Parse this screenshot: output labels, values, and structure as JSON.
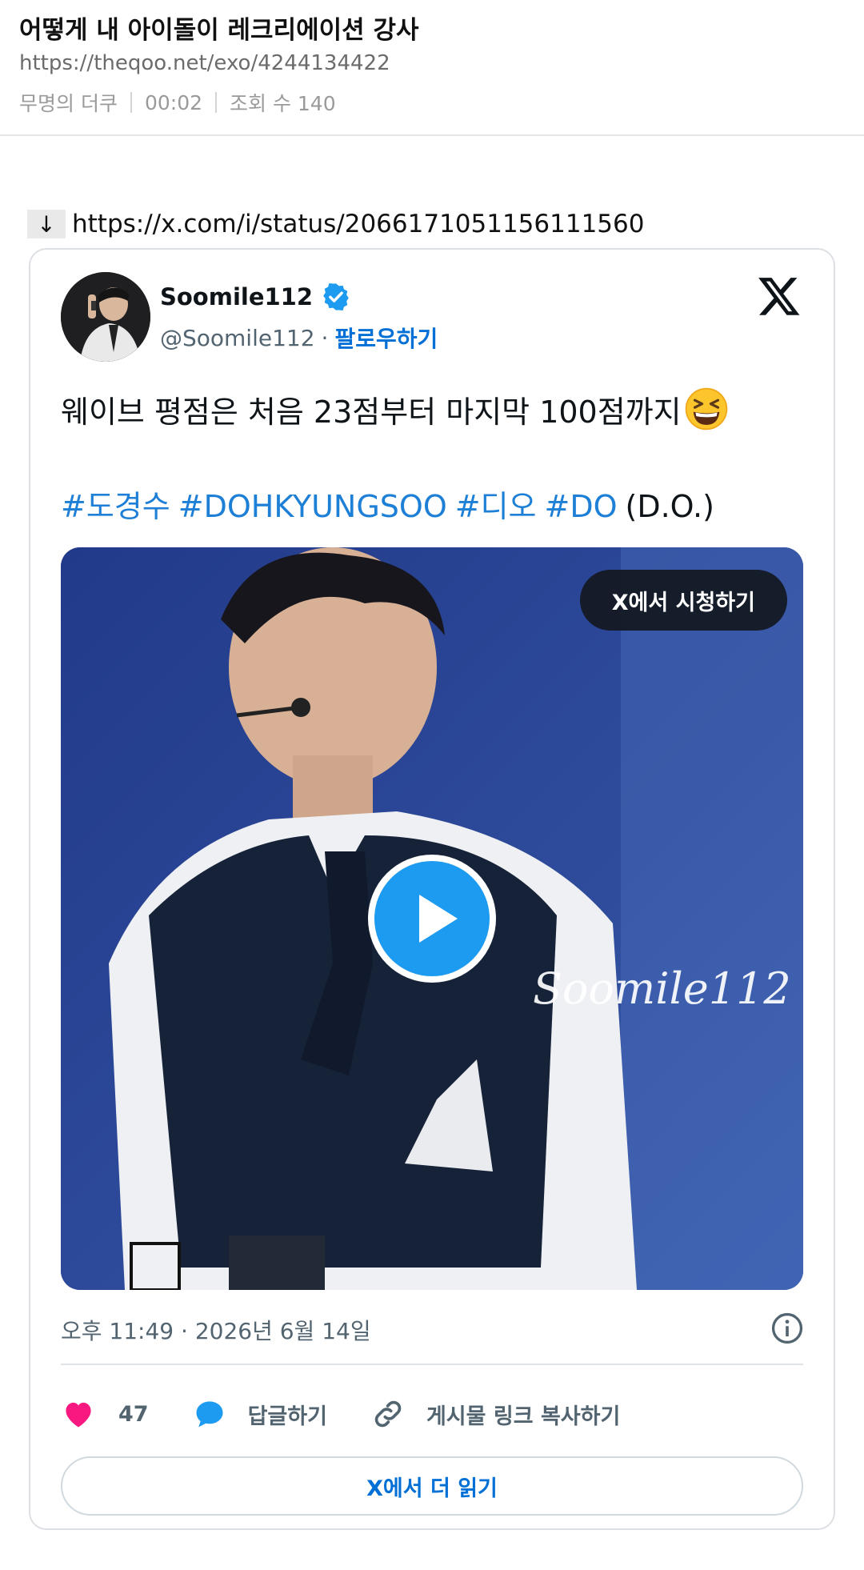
{
  "post": {
    "title": "어떻게 내 아이돌이 레크리에이션 강사",
    "url": "https://theqoo.net/exo/4244134422",
    "author": "무명의 더쿠",
    "time": "00:02",
    "views": "조회 수 140"
  },
  "source": {
    "arrow": "↓",
    "url": "https://x.com/i/status/2066171051156111560"
  },
  "tweet": {
    "display_name": "Soomile112",
    "handle": "@Soomile112",
    "separator": "·",
    "follow_label": "팔로우하기",
    "text": "웨이브 평점은 처음 23점부터 마지막 100점까지",
    "hashtags": [
      "#도경수",
      "#DOHKYUNGSOO",
      "#디오",
      "#DO"
    ],
    "trailing_text": "(D.O.)",
    "media": {
      "watch_label": "X에서 시청하기",
      "watermark": "Soomile112"
    },
    "timestamp": "오후 11:49 · 2026년 6월 14일",
    "like_count": "47",
    "reply_label": "답글하기",
    "copy_link_label": "게시물 링크 복사하기",
    "read_more_label": "X에서 더 읽기"
  },
  "colors": {
    "link_blue": "#006fd6",
    "hashtag_blue": "#1d7fd6",
    "like_pink": "#f91880",
    "reply_blue": "#1d9bf0",
    "play_blue": "#1d9bf0"
  }
}
